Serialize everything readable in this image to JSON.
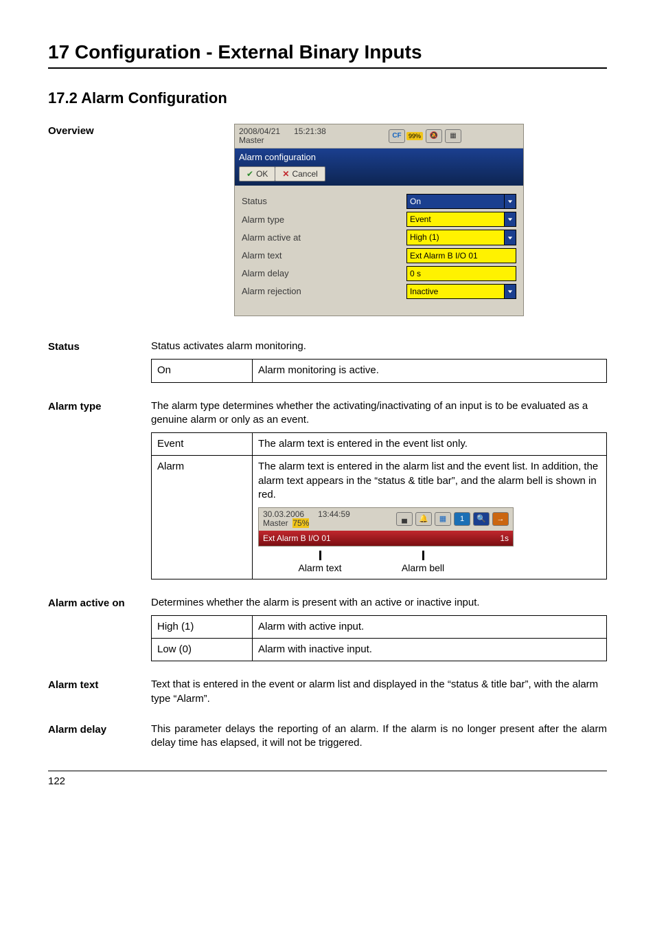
{
  "chapter_title": "17 Configuration - External Binary Inputs",
  "section_title": "17.2  Alarm Configuration",
  "labels": {
    "overview": "Overview",
    "status": "Status",
    "alarm_type": "Alarm type",
    "alarm_active_on": "Alarm active on",
    "alarm_text": "Alarm text",
    "alarm_delay": "Alarm delay"
  },
  "screenshot": {
    "date": "2008/04/21",
    "time": "15:21:38",
    "master": "Master",
    "cf": "CF",
    "pct": "99%",
    "title": "Alarm configuration",
    "btn_ok": "OK",
    "btn_cancel": "Cancel",
    "rows": [
      {
        "label": "Status",
        "value": "On",
        "dark": true,
        "dd": true
      },
      {
        "label": "Alarm type",
        "value": "Event",
        "dark": false,
        "dd": true
      },
      {
        "label": "Alarm active at",
        "value": "High (1)",
        "dark": false,
        "dd": true
      },
      {
        "label": "Alarm text",
        "value": "Ext Alarm B I/O 01",
        "dark": false,
        "dd": false
      },
      {
        "label": "Alarm delay",
        "value": "0 s",
        "dark": false,
        "dd": false
      },
      {
        "label": "Alarm rejection",
        "value": "Inactive",
        "dark": false,
        "dd": true
      }
    ]
  },
  "status_text": "Status activates alarm monitoring.",
  "status_table": {
    "key": "On",
    "val": "Alarm monitoring is active."
  },
  "alarm_type_text": "The alarm type determines whether the activating/inactivating of an input is to be evaluated as a genuine alarm or only as an event.",
  "alarm_type_table": {
    "event_key": "Event",
    "event_val": "The alarm text is entered in the event list only.",
    "alarm_key": "Alarm",
    "alarm_val": "The alarm text is entered in the alarm list and the event list. In addition, the alarm text appears in the “status & title bar”, and the alarm bell is shown in red.",
    "mini": {
      "date": "30.03.2006",
      "time": "13:44:59",
      "master": "Master",
      "pct": "75%",
      "redtext": "Ext Alarm B I/O 01",
      "redright": "1s",
      "lbl_text": "Alarm text",
      "lbl_bell": "Alarm bell"
    }
  },
  "alarm_active_text": "Determines whether the alarm is present with an active or inactive input.",
  "alarm_active_table": [
    {
      "key": "High (1)",
      "val": "Alarm with active input."
    },
    {
      "key": "Low (0)",
      "val": "Alarm with inactive input."
    }
  ],
  "alarm_text_para": "Text that is entered in the event or alarm list and displayed in the “status & title bar”, with the alarm type “Alarm”.",
  "alarm_delay_para": "This parameter delays the reporting of an alarm. If the alarm is no longer present after the alarm delay time has elapsed, it will not be triggered.",
  "page_no": "122"
}
